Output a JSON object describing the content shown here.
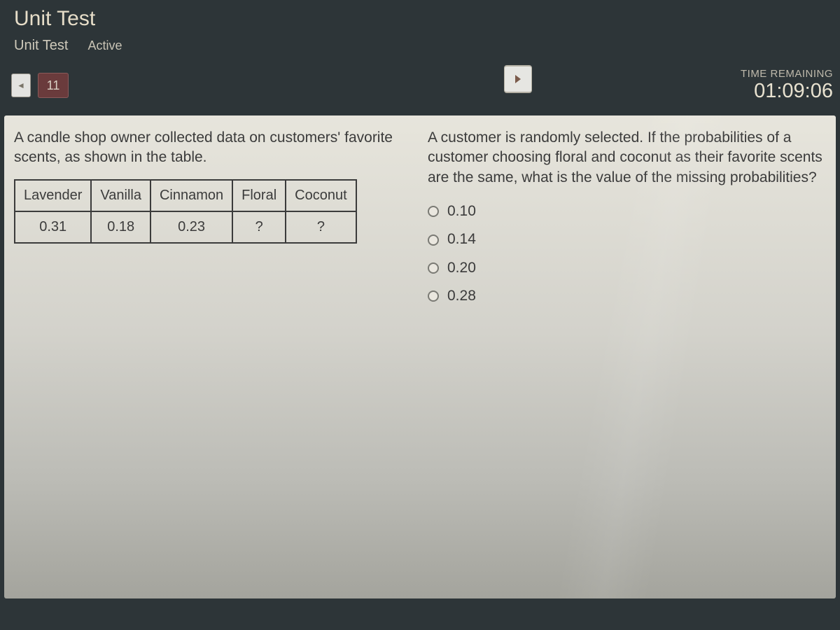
{
  "header": {
    "title": "Unit Test",
    "tab_label": "Unit Test",
    "status_label": "Active"
  },
  "nav": {
    "prev_arrow": "◄",
    "question_number": "11",
    "play_label": "►",
    "timer_label": "TIME REMAINING",
    "timer_value": "01:09:06"
  },
  "left": {
    "prompt": "A candle shop owner collected data on customers' favorite scents, as shown in the table.",
    "table": {
      "headers": [
        "Lavender",
        "Vanilla",
        "Cinnamon",
        "Floral",
        "Coconut"
      ],
      "values": [
        "0.31",
        "0.18",
        "0.23",
        "?",
        "?"
      ]
    }
  },
  "right": {
    "question": "A customer is randomly selected. If the probabilities of a customer choosing floral and coconut as their favorite scents are the same, what is the value of the missing probabilities?",
    "options": [
      "0.10",
      "0.14",
      "0.20",
      "0.28"
    ]
  }
}
